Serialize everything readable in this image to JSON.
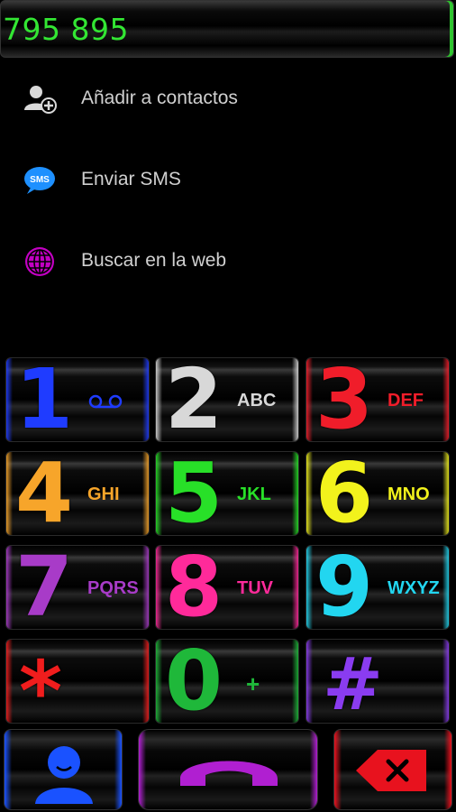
{
  "display": {
    "number": "795 895"
  },
  "actions": [
    {
      "label": "Añadir a contactos",
      "icon": "add-contact-icon"
    },
    {
      "label": "Enviar SMS",
      "icon": "sms-icon",
      "icon_text": "SMS"
    },
    {
      "label": "Buscar en la web",
      "icon": "globe-icon"
    }
  ],
  "keypad": [
    {
      "digit": "1",
      "letters": "",
      "color": "#1f3cff",
      "icon": "voicemail-icon"
    },
    {
      "digit": "2",
      "letters": "ABC",
      "color": "#d8d8d8"
    },
    {
      "digit": "3",
      "letters": "DEF",
      "color": "#f01d2a"
    },
    {
      "digit": "4",
      "letters": "GHI",
      "color": "#f7a52a"
    },
    {
      "digit": "5",
      "letters": "JKL",
      "color": "#28e028"
    },
    {
      "digit": "6",
      "letters": "MNO",
      "color": "#f2f21c"
    },
    {
      "digit": "7",
      "letters": "PQRS",
      "color": "#a83bc8"
    },
    {
      "digit": "8",
      "letters": "TUV",
      "color": "#ff2a9a"
    },
    {
      "digit": "9",
      "letters": "WXYZ",
      "color": "#22d6f0"
    },
    {
      "digit": "*",
      "letters": "",
      "color": "#f01d1d"
    },
    {
      "digit": "0",
      "letters": "+",
      "color": "#1fb83a"
    },
    {
      "digit": "#",
      "letters": "",
      "color": "#8a3cf0"
    }
  ],
  "bottom": {
    "contacts_icon": "contact-person-icon",
    "call_icon": "call-handset-icon",
    "delete_icon": "backspace-icon",
    "contacts_color": "#1a52ff",
    "call_color": "#b01fd1",
    "delete_color": "#e8121e"
  }
}
